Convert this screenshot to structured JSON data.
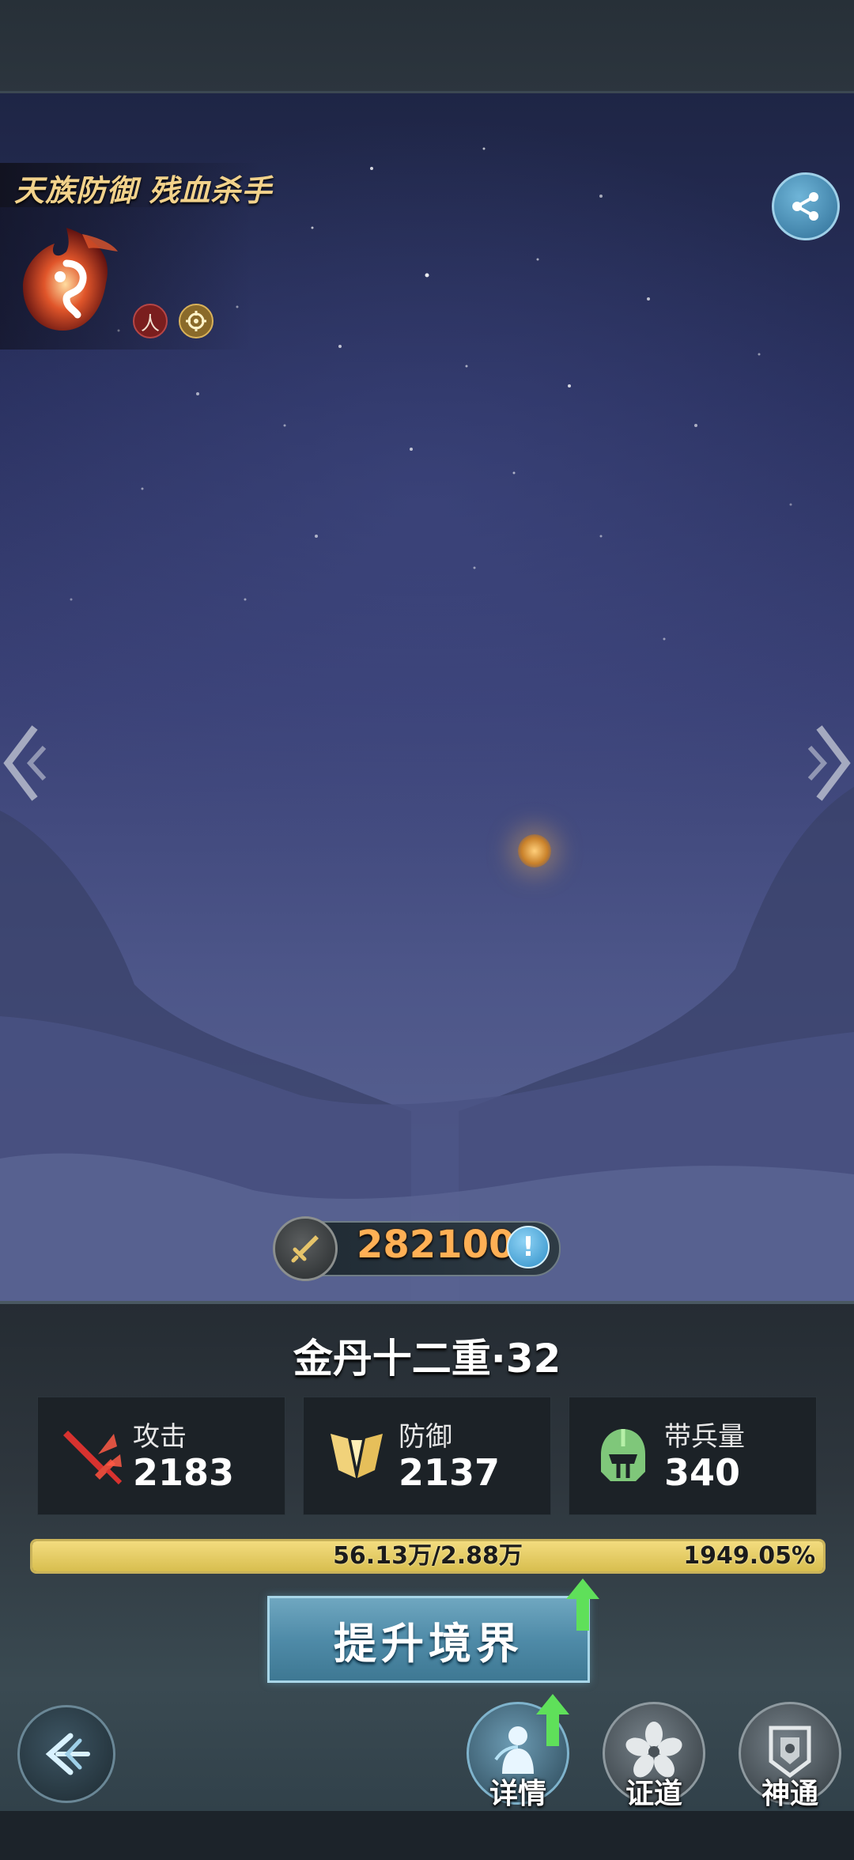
{
  "hero": {
    "title": "天族防御 残血杀手",
    "element_emblem": "fire-emblem-icon",
    "tags": [
      {
        "glyph": "人",
        "icon": "person-tag-icon",
        "color": "#7a1e1e"
      },
      {
        "glyph": "",
        "icon": "target-tag-icon",
        "color": "#8a6a2a"
      }
    ]
  },
  "buttons": {
    "share_icon": "share-icon",
    "prev_icon": "chevron-left-icon",
    "next_icon": "chevron-right-icon",
    "back_icon": "back-arrow-icon"
  },
  "power": {
    "value": "282100",
    "info_glyph": "!",
    "icon": "sword-icon"
  },
  "realm": {
    "title": "金丹十二重·32"
  },
  "stats": [
    {
      "label": "攻击",
      "value": "2183",
      "icon": "sword-slash-icon",
      "color": "#e0413b"
    },
    {
      "label": "防御",
      "value": "2137",
      "icon": "shield-icon",
      "color": "#f1d27a"
    },
    {
      "label": "带兵量",
      "value": "340",
      "icon": "helmet-icon",
      "color": "#7fc77a"
    }
  ],
  "progress": {
    "text": "56.13万/2.88万",
    "percent_text": "1949.05%",
    "fill_fraction": 1.0,
    "color": "#e8cf6a"
  },
  "upgrade": {
    "label": "提升境界"
  },
  "nav": [
    {
      "label": "详情",
      "icon": "detail-figure-icon"
    },
    {
      "label": "证道",
      "icon": "flower-icon"
    },
    {
      "label": "神通",
      "icon": "emblem-icon"
    }
  ]
}
